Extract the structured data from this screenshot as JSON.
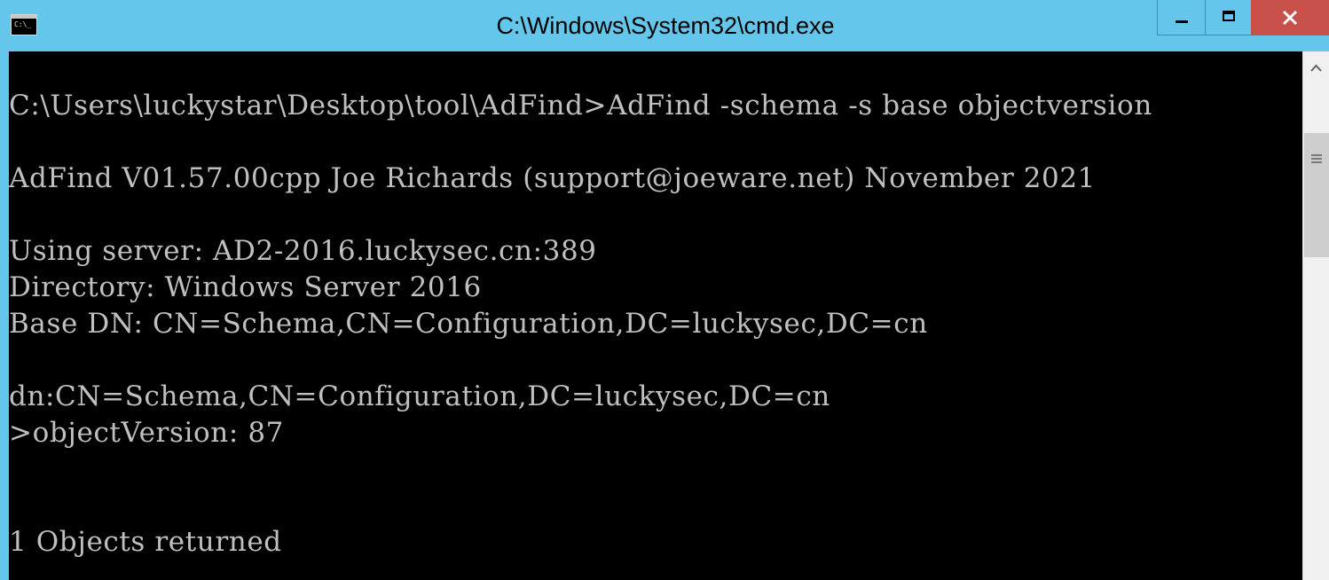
{
  "window": {
    "title": "C:\\Windows\\System32\\cmd.exe",
    "icon": "cmd-icon",
    "icon_text": "C:\\_",
    "controls": {
      "minimize": "minimize-icon",
      "maximize": "maximize-icon",
      "close": "close-icon"
    },
    "colors": {
      "titlebar": "#63c6ea",
      "close_button": "#c7504a",
      "console_bg": "#000000",
      "console_text": "#c0c0c0"
    }
  },
  "console": {
    "lines": [
      "C:\\Users\\luckystar\\Desktop\\tool\\AdFind>AdFind -schema -s base objectversion",
      "AdFind V01.57.00cpp Joe Richards (support@joeware.net) November 2021",
      "Using server: AD2-2016.luckysec.cn:389",
      "Directory: Windows Server 2016",
      "Base DN: CN=Schema,CN=Configuration,DC=luckysec,DC=cn",
      "dn:CN=Schema,CN=Configuration,DC=luckysec,DC=cn",
      ">objectVersion: 87",
      "1 Objects returned"
    ]
  }
}
